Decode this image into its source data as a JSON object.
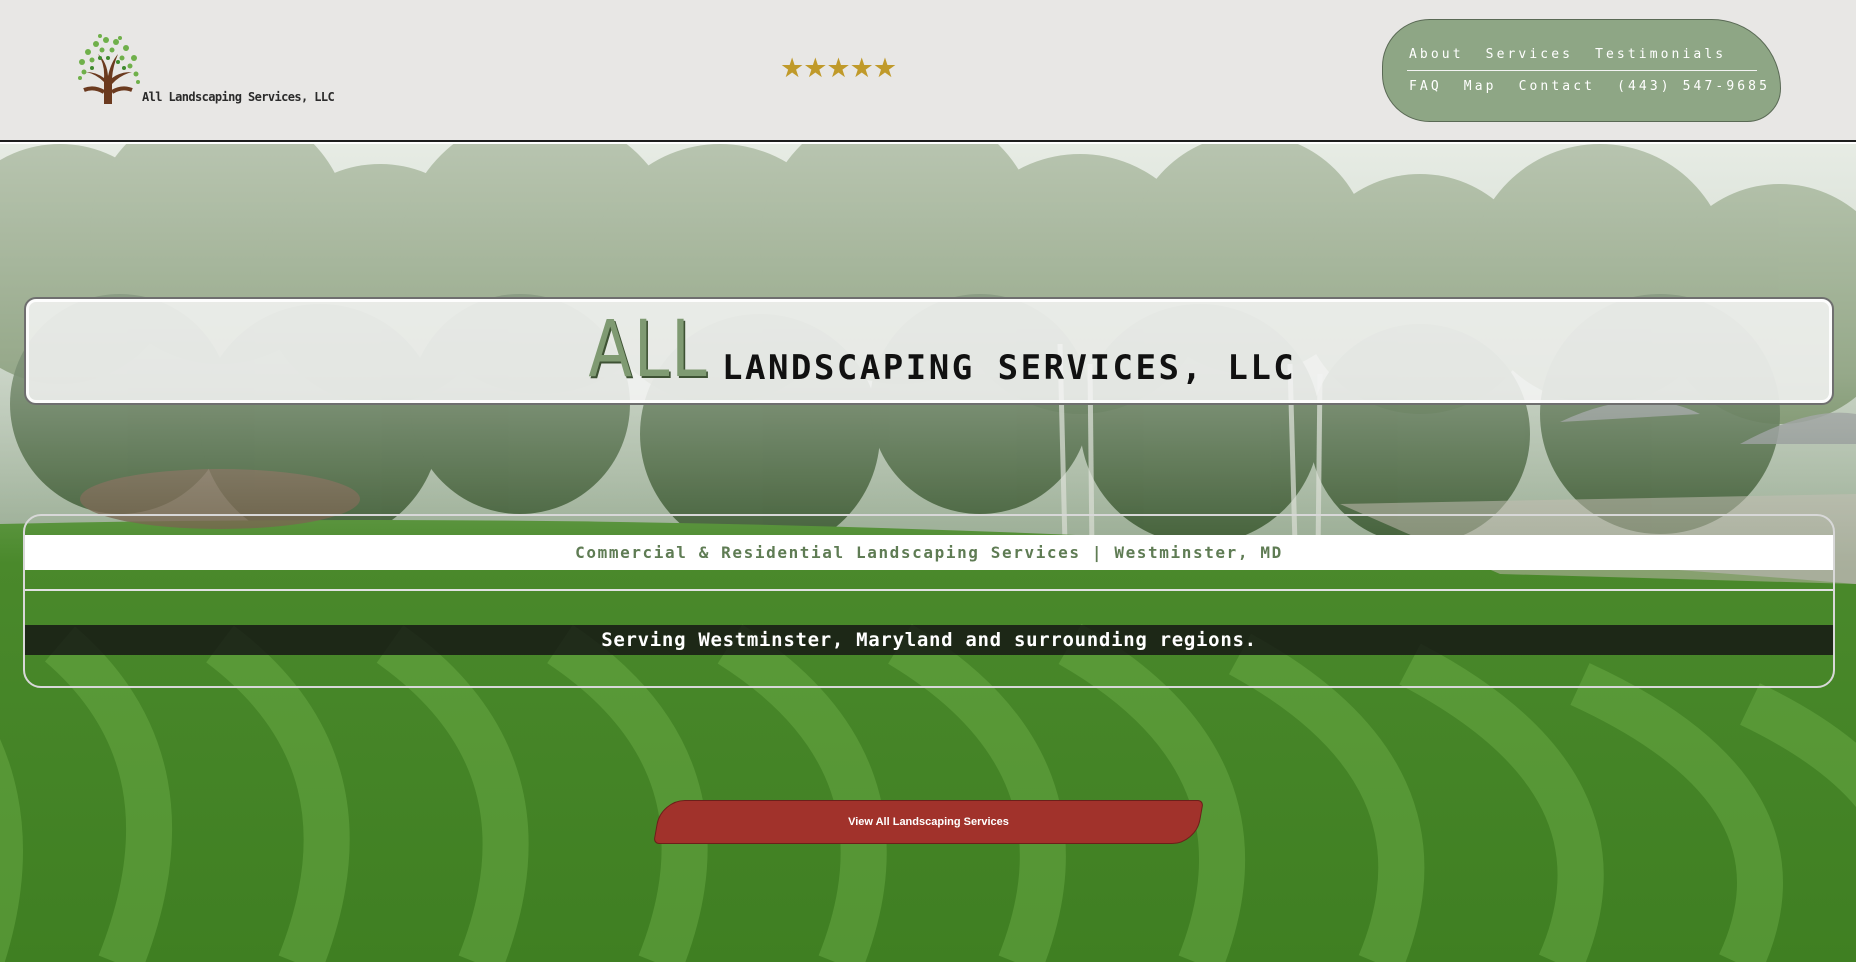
{
  "header": {
    "logo_text": "All Landscaping Services, LLC",
    "rating_stars": "★★★★★",
    "rating": 5
  },
  "nav": {
    "row1": [
      "About",
      "Services",
      "Testimonials"
    ],
    "row2": [
      "FAQ",
      "Map",
      "Contact",
      "(443) 547-9685"
    ]
  },
  "hero": {
    "title_all": "ALL",
    "title_rest": "LANDSCAPING SERVICES, LLC",
    "tagline": "Commercial & Residential Landscaping Services | Westminster, MD",
    "serving": "Serving Westminster, Maryland and surrounding regions.",
    "cta_label": "View All Landscaping Services"
  },
  "colors": {
    "header_bg": "#e8e7e5",
    "nav_bg": "#8ea685",
    "accent_green": "#7f9a72",
    "cta_red": "#a1322b",
    "star_gold": "#c09a2a"
  }
}
